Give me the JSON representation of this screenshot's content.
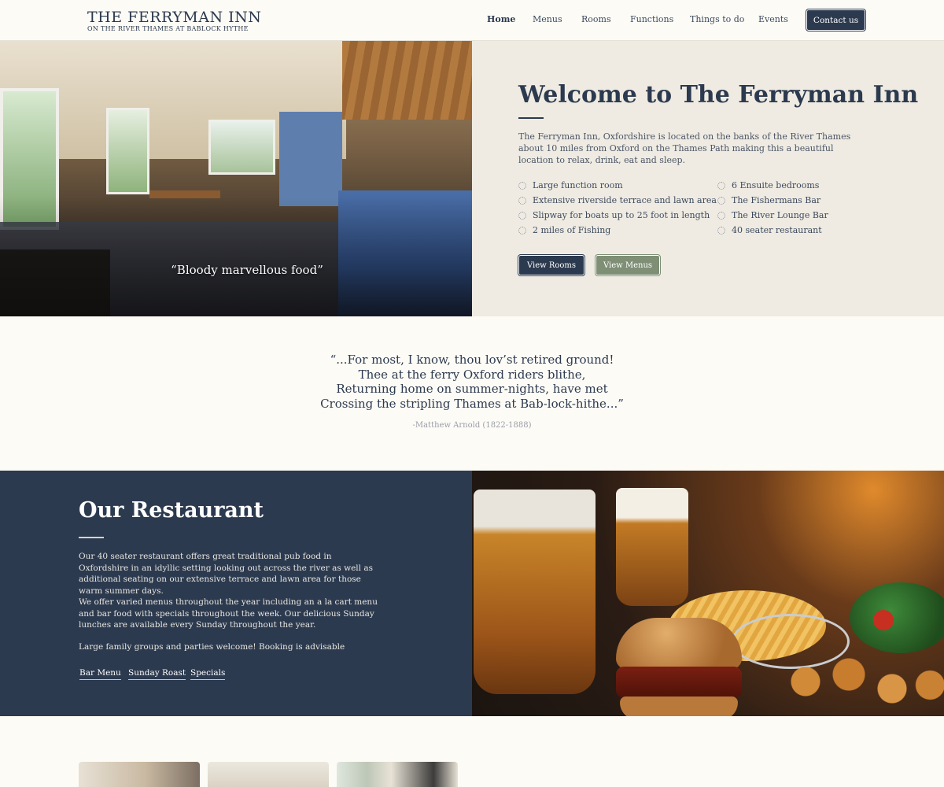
{
  "header": {
    "logo_title": "THE FERRYMAN INN",
    "logo_subtitle": "ON THE RIVER THAMES AT BABLOCK HYTHE",
    "nav": [
      "Home",
      "Menus",
      "Rooms",
      "Functions",
      "Things to do",
      "Events"
    ],
    "active_nav": "Home",
    "contact_label": "Contact us"
  },
  "hero": {
    "caption": "“Bloody marvellous food”",
    "slide_count": 5,
    "active_slide": 1,
    "title": "Welcome to The Ferryman Inn",
    "intro": "The Ferryman Inn, Oxfordshire is located on the banks of the River  Thames about 10 miles from Oxford on the Thames Path making this a  beautiful location to relax, drink, eat and sleep.",
    "features_left": [
      "Large function room",
      "Extensive riverside terrace and lawn area",
      "Slipway for boats up to 25 foot in length",
      "2 miles of Fishing"
    ],
    "features_right": [
      "6 Ensuite bedrooms",
      "The Fishermans Bar",
      "The River Lounge Bar",
      "40 seater restaurant"
    ],
    "view_rooms_label": "View Rooms",
    "view_menus_label": "View Menus"
  },
  "quote": {
    "lines": [
      "“...For most, I know, thou lov’st retired ground!",
      "Thee at the ferry Oxford riders blithe,",
      "Returning home on summer-nights, have met",
      "Crossing the stripling Thames at Bab-lock-hithe...”"
    ],
    "author": "-Matthew Arnold (1822-1888)"
  },
  "restaurant": {
    "title": "Our Restaurant",
    "paragraphs": [
      "Our 40 seater restaurant offers great traditional pub food in  Oxfordshire in an idyllic setting looking out across the river as well  as additional seating on our extensive terrace and lawn area for those  warm summer days.",
      "We offer varied menus throughout the year including an a la cart menu and bar food with specials throughout the week.  Our delicious Sunday lunches are available every Sunday throughout the year.",
      "Large family groups and parties welcome! Booking is advisable"
    ],
    "links": [
      "Bar Menu",
      "Sunday Roast",
      "Specials"
    ]
  },
  "colors": {
    "navy": "#2c3a4f",
    "sage": "#7e8f75",
    "cream": "#fdfbf6",
    "panel": "#efebe2"
  }
}
